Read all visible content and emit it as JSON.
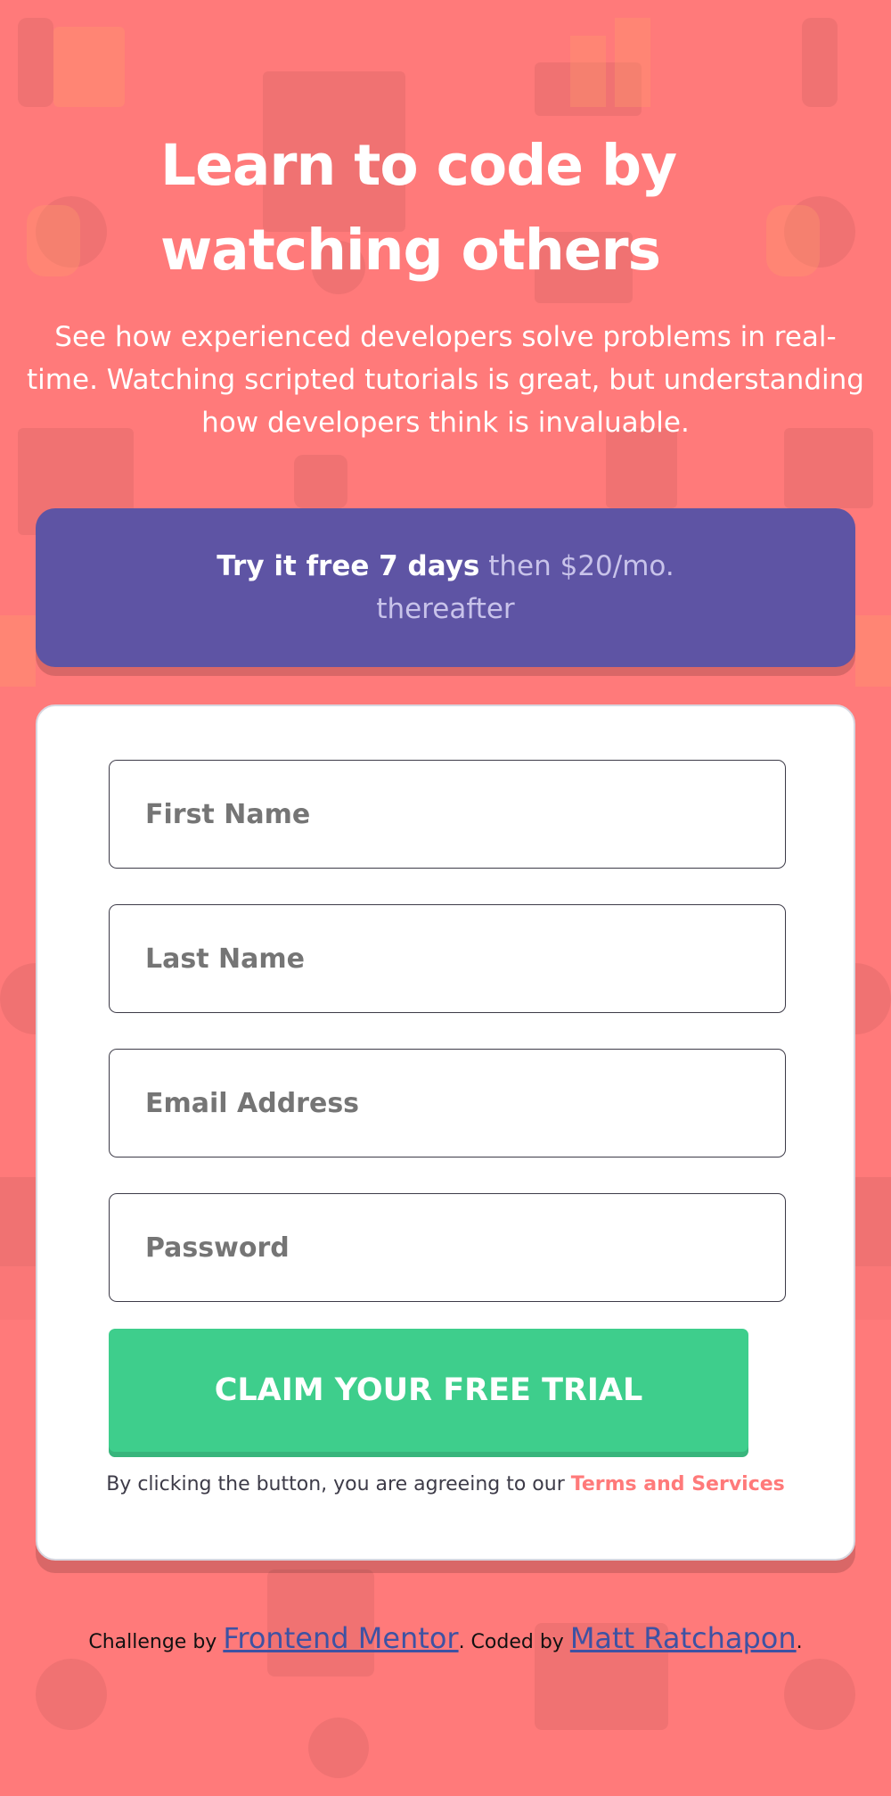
{
  "hero": {
    "title": "Learn to code by watching others",
    "description": "See how experienced developers solve problems in real-time. Watching scripted tutorials is great, but understanding how developers think is invaluable."
  },
  "offer": {
    "strong": "Try it free 7 days",
    "rest": " then $20/mo. thereafter"
  },
  "form": {
    "first_name_placeholder": "First Name",
    "last_name_placeholder": "Last Name",
    "email_placeholder": "Email Address",
    "password_placeholder": "Password",
    "submit_label": "CLAIM YOUR FREE TRIAL",
    "terms_prefix": "By clicking the button, you are agreeing to our ",
    "terms_link": "Terms and Services"
  },
  "attribution": {
    "prefix": "Challenge by ",
    "mentor_link": "Frontend Mentor",
    "middle": ". Coded by ",
    "author_link": "Matt Ratchapon",
    "suffix": "."
  },
  "colors": {
    "background": "#ff7a7a",
    "banner": "#5e54a4",
    "button": "#3ece8c",
    "link": "#ff7a7a"
  }
}
